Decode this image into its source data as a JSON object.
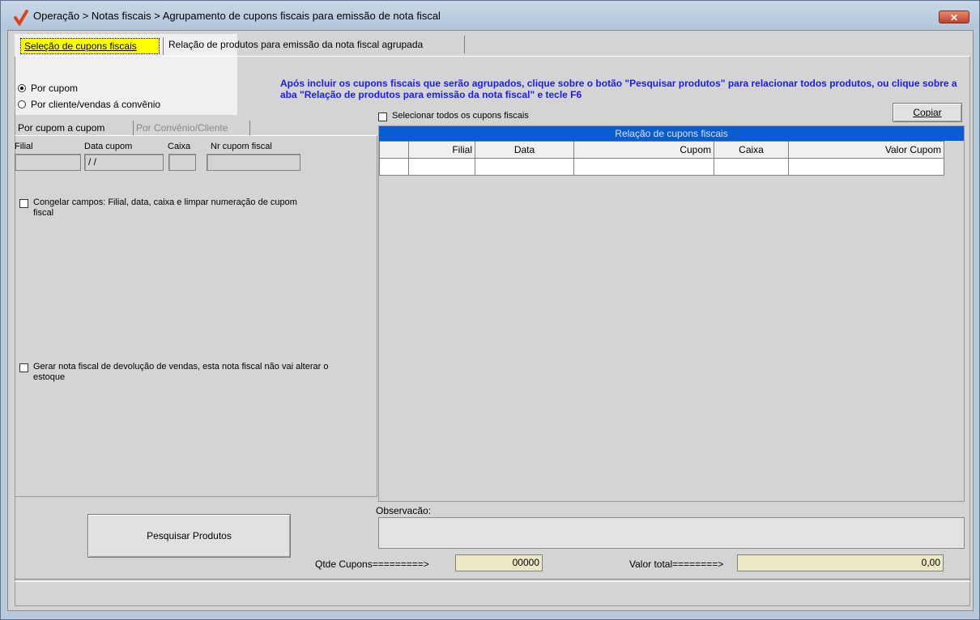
{
  "window": {
    "title": "Operação > Notas fiscais > Agrupamento de cupons fiscais para emissão de nota fiscal",
    "close_glyph": "✕"
  },
  "tabs": [
    {
      "label": "Seleção de cupons fiscais",
      "active": true
    },
    {
      "label": "Relação de produtos para emissão da nota fiscal agrupada",
      "active": false
    }
  ],
  "mode": {
    "options": [
      {
        "label": "Por cupom",
        "selected": true
      },
      {
        "label": "Por cliente/vendas á convênio",
        "selected": false
      }
    ]
  },
  "info_text": "Após incluir os cupons fiscais que serão agrupados, clique sobre o botão \"Pesquisar produtos\" para relacionar todos produtos, ou clique sobre a aba \"Relação de produtos para emissão da nota fiscal\" e tecle F6",
  "copy_button": "Copiar",
  "select_all": "Selecionar todos os cupons fiscais",
  "subtabs": [
    {
      "label": "Por cupom a cupom",
      "active": true
    },
    {
      "label": "Por Convênio/Cliente",
      "active": false
    }
  ],
  "fields": {
    "filial_label": "Filial",
    "data_label": "Data cupom",
    "data_value": " / /",
    "caixa_label": "Caixa",
    "nr_label": "Nr cupom fiscal"
  },
  "freeze_checkbox": "Congelar campos: Filial, data, caixa e limpar numeração de cupom fiscal",
  "return_checkbox": "Gerar nota fiscal de devolução de vendas, esta nota fiscal não vai alterar o estoque",
  "grid": {
    "title": "Relação de cupons fiscais",
    "columns": [
      "",
      "Filial",
      "Data",
      "Cupom",
      "Caixa",
      "Valor Cupom"
    ]
  },
  "observacao_label": "Observacão:",
  "search_button": "Pesquisar Produtos",
  "qtde_label": "Qtde Cupons=========>",
  "qtde_value": "00000",
  "valor_label": "Valor total========>",
  "valor_value": "0,00",
  "colors": {
    "accent_tab": "#ffff00",
    "grid_header": "#0b5bd3",
    "info_text": "#1a1aff"
  }
}
